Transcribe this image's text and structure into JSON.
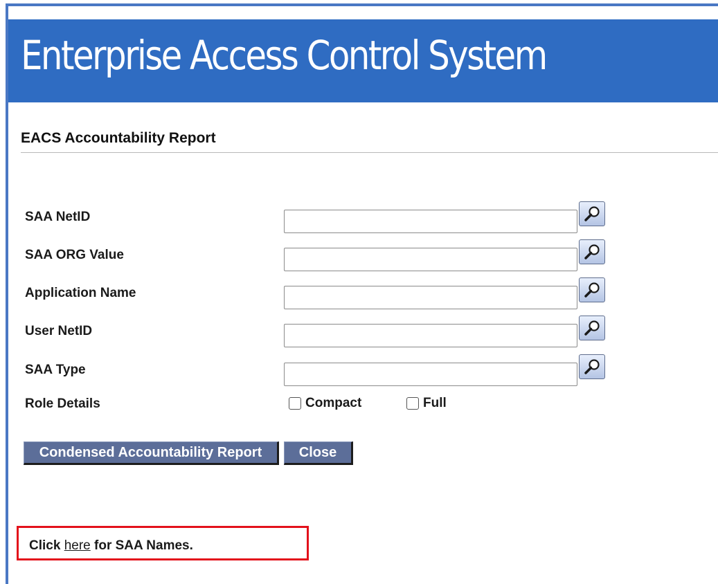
{
  "banner": {
    "title": "Enterprise Access Control System"
  },
  "page": {
    "heading": "EACS Accountability Report"
  },
  "form": {
    "fields": [
      {
        "label": "SAA NetID",
        "value": "",
        "lookup_icon": "magnifier-icon"
      },
      {
        "label": "SAA ORG Value",
        "value": "",
        "lookup_icon": "magnifier-icon"
      },
      {
        "label": "Application Name",
        "value": "",
        "lookup_icon": "magnifier-icon"
      },
      {
        "label": "User NetID",
        "value": "",
        "lookup_icon": "magnifier-icon"
      },
      {
        "label": "SAA Type",
        "value": "",
        "lookup_icon": "magnifier-icon"
      }
    ],
    "role_details": {
      "label": "Role Details",
      "options": [
        {
          "label": "Compact",
          "checked": false
        },
        {
          "label": "Full",
          "checked": false
        }
      ]
    }
  },
  "actions": {
    "report_label": "Condensed Accountability Report",
    "close_label": "Close"
  },
  "note": {
    "prefix": "Click ",
    "link_text": "here",
    "suffix": " for SAA Names."
  },
  "colors": {
    "banner": "#2f6cc2",
    "button": "#5c6e99",
    "highlight_border": "#e3111b"
  }
}
